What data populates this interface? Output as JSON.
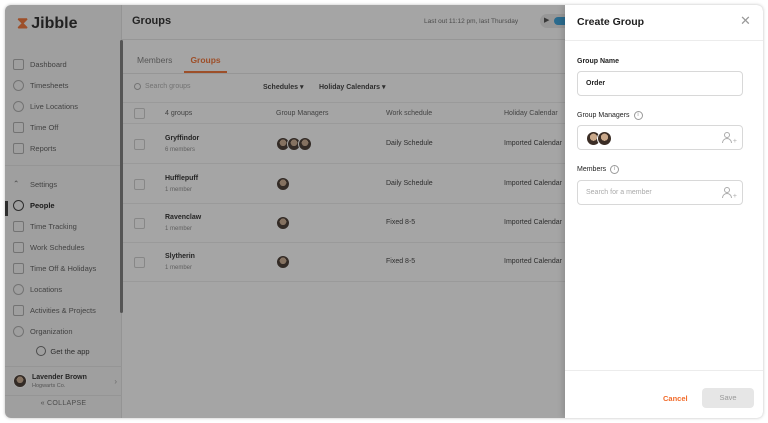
{
  "app": {
    "logo_text": "Jibble"
  },
  "sidebar": {
    "items": [
      {
        "label": "Dashboard"
      },
      {
        "label": "Timesheets"
      },
      {
        "label": "Live Locations"
      },
      {
        "label": "Time Off"
      },
      {
        "label": "Reports"
      },
      {
        "label": "Settings"
      },
      {
        "label": "People"
      },
      {
        "label": "Time Tracking"
      },
      {
        "label": "Work Schedules"
      },
      {
        "label": "Time Off & Holidays"
      },
      {
        "label": "Locations"
      },
      {
        "label": "Activities & Projects"
      },
      {
        "label": "Organization"
      }
    ],
    "get_app": "Get the app",
    "user": {
      "name": "Lavender Brown",
      "org": "Hogwarts Co."
    },
    "collapse": "COLLAPSE"
  },
  "header": {
    "title": "Groups",
    "last_out": "Last out 11:12 pm, last Thursday"
  },
  "tabs": [
    {
      "label": "Members"
    },
    {
      "label": "Groups"
    }
  ],
  "filters": {
    "search_placeholder": "Search groups",
    "schedules": "Schedules ▾",
    "holiday_calendars": "Holiday Calendars ▾"
  },
  "table": {
    "headers": [
      "4 groups",
      "Group Managers",
      "Work schedule",
      "Holiday Calendar"
    ],
    "rows": [
      {
        "name": "Gryffindor",
        "members": "6 members",
        "schedule": "Daily Schedule",
        "calendar": "Imported Calendar"
      },
      {
        "name": "Hufflepuff",
        "members": "1 member",
        "schedule": "Daily Schedule",
        "calendar": "Imported Calendar"
      },
      {
        "name": "Ravenclaw",
        "members": "1 member",
        "schedule": "Fixed 8-5",
        "calendar": "Imported Calendar"
      },
      {
        "name": "Slytherin",
        "members": "1 member",
        "schedule": "Fixed 8-5",
        "calendar": "Imported Calendar"
      }
    ]
  },
  "drawer": {
    "title": "Create Group",
    "close": "✕",
    "group_name_label": "Group Name",
    "group_name_value": "Order",
    "managers_label": "Group Managers",
    "members_label": "Members",
    "members_placeholder": "Search for a member",
    "cancel": "Cancel",
    "save": "Save"
  },
  "colors": {
    "accent": "#f26b2a",
    "overlay": "#282828"
  }
}
